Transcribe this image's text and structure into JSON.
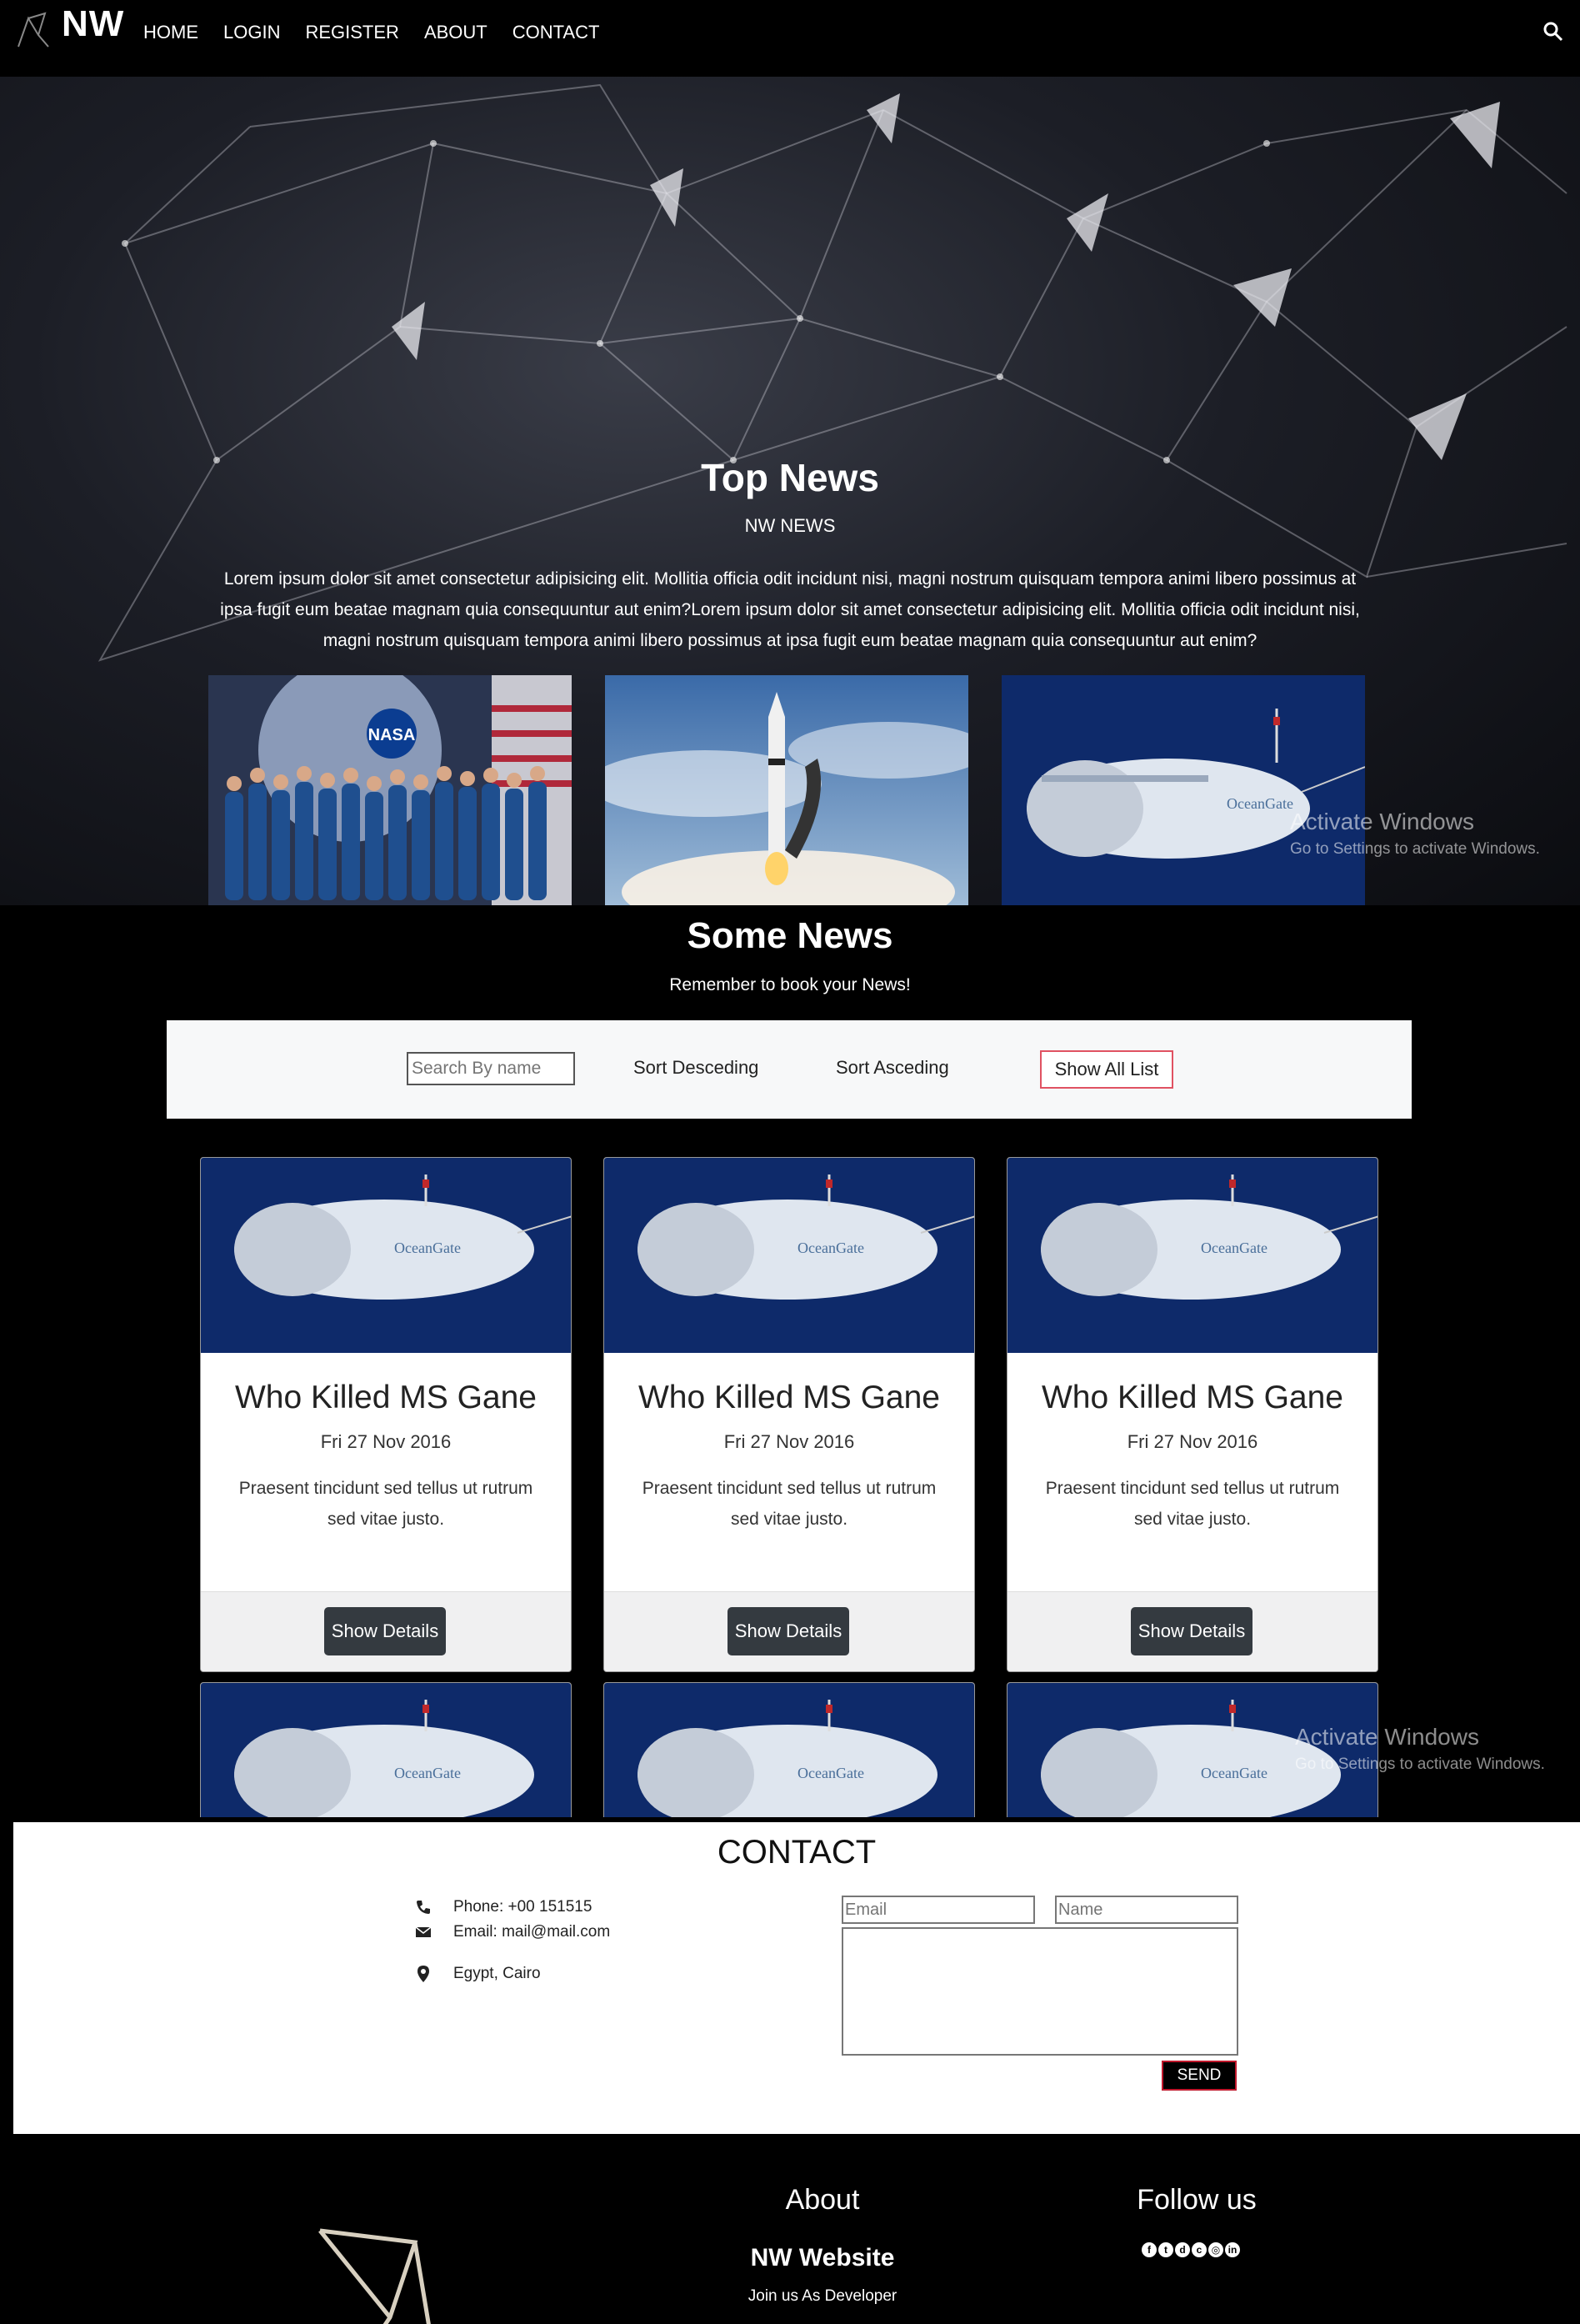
{
  "nav": {
    "brand": "NW",
    "links": [
      "HOME",
      "LOGIN",
      "REGISTER",
      "ABOUT",
      "CONTACT"
    ]
  },
  "hero": {
    "title": "Top News",
    "subtitle": "NW NEWS",
    "text": "Lorem ipsum dolor sit amet consectetur adipisicing elit. Mollitia officia odit incidunt nisi, magni nostrum quisquam tempora animi libero possimus at ipsa fugit eum beatae magnam quia consequuntur aut enim?Lorem ipsum dolor sit amet consectetur adipisicing elit. Mollitia officia odit incidunt nisi, magni nostrum quisquam tempora animi libero possimus at ipsa fugit eum beatae magnam quia consequuntur aut enim?",
    "images": [
      "astronaut-group-photo",
      "rocket-launch-photo",
      "submersible-photo"
    ],
    "watermark": [
      "Activate Windows",
      "Go to Settings to activate Windows."
    ]
  },
  "news": {
    "title": "Some News",
    "subtitle": "Remember to book your News!",
    "search_placeholder": "Search By name",
    "sort_desc": "Sort Desceding",
    "sort_asc": "Sort Asceding",
    "show_all": "Show All List",
    "cards": [
      {
        "title": "Who Killed MS Gane",
        "date": "Fri 27 Nov 2016",
        "text": "Praesent tincidunt sed tellus ut rutrum sed vitae justo.",
        "button": "Show Details"
      },
      {
        "title": "Who Killed MS Gane",
        "date": "Fri 27 Nov 2016",
        "text": "Praesent tincidunt sed tellus ut rutrum sed vitae justo.",
        "button": "Show Details"
      },
      {
        "title": "Who Killed MS Gane",
        "date": "Fri 27 Nov 2016",
        "text": "Praesent tincidunt sed tellus ut rutrum sed vitae justo.",
        "button": "Show Details"
      }
    ],
    "watermark": [
      "Activate Windows",
      "Go to Settings to activate Windows."
    ]
  },
  "contact": {
    "title": "CONTACT",
    "phone": "Phone: +00 151515",
    "email": "Email: mail@mail.com",
    "address": "Egypt, Cairo",
    "email_placeholder": "Email",
    "name_placeholder": "Name",
    "send": "SEND"
  },
  "footer": {
    "about_heading": "About",
    "site_name": "NW Website",
    "join": "Join us As Developer",
    "follow_heading": "Follow us",
    "social_icons": [
      "facebook-icon",
      "twitter-icon",
      "discord-icon",
      "cloud-icon",
      "instagram-icon",
      "linkedin-icon"
    ]
  },
  "colors": {
    "accent_border": "#e05262",
    "send_border": "#c0182c",
    "button_dark": "#343a40"
  }
}
